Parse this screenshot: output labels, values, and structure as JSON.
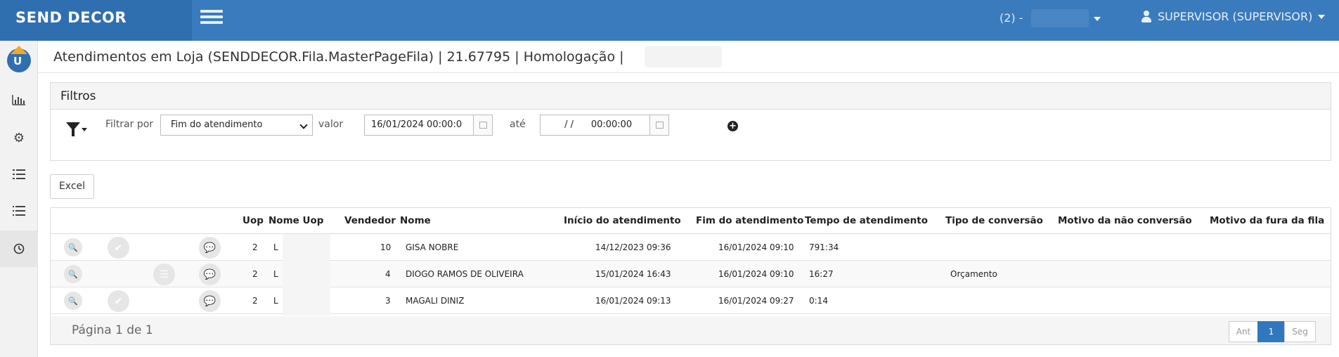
{
  "brand": "SEND DECOR",
  "topbar": {
    "env_label": "(2) -",
    "user_label": "SUPERVISOR (SUPERVISOR)"
  },
  "sidebar": {
    "items": [
      {
        "icon": "logo-icon"
      },
      {
        "icon": "bar-chart-icon",
        "glyph": "┃┃┃"
      },
      {
        "icon": "gears-icon",
        "glyph": "⚙"
      },
      {
        "icon": "list-ordered-icon",
        "glyph": "☰"
      },
      {
        "icon": "list-icon",
        "glyph": "☰"
      },
      {
        "icon": "clock-icon",
        "glyph": "◷"
      }
    ]
  },
  "page": {
    "title": "Atendimentos em Loja (SENDDECOR.Fila.MasterPageFila) | 21.67795 | Homologação |"
  },
  "filters": {
    "heading": "Filtros",
    "filter_by_label": "Filtrar por",
    "selected_field": "Fim do atendimento",
    "value_label": "valor",
    "from_value": "16/01/2024 00:00:0",
    "until_label": "até",
    "to_value": " / /      00:00:00"
  },
  "excel_label": "Excel",
  "table": {
    "headers": {
      "uop": "Uop",
      "nome_uop": "Nome Uop",
      "vendedor": "Vendedor",
      "nome": "Nome",
      "inicio": "Início do atendimento",
      "fim": "Fim do atendimento",
      "tempo": "Tempo de atendimento",
      "tipo": "Tipo de conversão",
      "motivo_nao": "Motivo da não conversão",
      "motivo_fura": "Motivo da fura da fila"
    },
    "rows": [
      {
        "uop": "2",
        "nome_uop": "L",
        "vendedor": "10",
        "nome": "GISA NOBRE",
        "inicio": "14/12/2023 09:36",
        "fim": "16/01/2024 09:10",
        "tempo": "791:34",
        "tipo": "",
        "motivo_nao": "",
        "motivo_fura": ""
      },
      {
        "uop": "2",
        "nome_uop": "L",
        "vendedor": "4",
        "nome": "DIOGO RAMOS DE OLIVEIRA",
        "inicio": "15/01/2024 16:43",
        "fim": "16/01/2024 09:10",
        "tempo": "16:27",
        "tipo": "Orçamento",
        "motivo_nao": "",
        "motivo_fura": ""
      },
      {
        "uop": "2",
        "nome_uop": "L",
        "vendedor": "3",
        "nome": "MAGALI DINIZ",
        "inicio": "16/01/2024 09:13",
        "fim": "16/01/2024 09:27",
        "tempo": "0:14",
        "tipo": "",
        "motivo_nao": "",
        "motivo_fura": ""
      }
    ]
  },
  "pager": {
    "info": "Página 1 de 1",
    "prev": "Ant",
    "current": "1",
    "next": "Seg"
  },
  "colors": {
    "topbar": "#3a7bbd",
    "brand_bg": "#2f6fb0",
    "pager_active": "#2f78bf"
  }
}
